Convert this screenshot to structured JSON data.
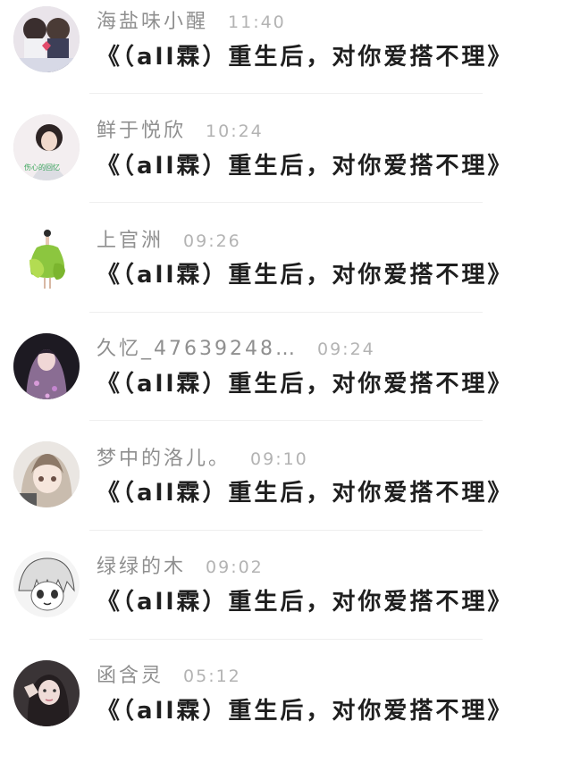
{
  "messages": [
    {
      "sender": "海盐味小醒",
      "time": "11:40",
      "text": "《（all霖）重生后，对你爱搭不理》",
      "avatar": "anime-couple-avatar"
    },
    {
      "sender": "鲜于悦欣",
      "time": "10:24",
      "text": "《（all霖）重生后，对你爱搭不理》",
      "avatar": "girl-photo-avatar",
      "avatar_caption": "伤心的回忆"
    },
    {
      "sender": "上官洲",
      "time": "09:26",
      "text": "《（all霖）重生后，对你爱搭不理》",
      "avatar": "green-dress-avatar"
    },
    {
      "sender": "久忆_47639248…",
      "time": "09:24",
      "text": "《（all霖）重生后，对你爱搭不理》",
      "avatar": "hooded-girl-avatar"
    },
    {
      "sender": "梦中的洛儿。",
      "time": "09:10",
      "text": "《（all霖）重生后，对你爱搭不理》",
      "avatar": "anime-girl-avatar"
    },
    {
      "sender": "绿绿的木",
      "time": "09:02",
      "text": "《（all霖）重生后，对你爱搭不理》",
      "avatar": "manga-girl-avatar"
    },
    {
      "sender": "函含灵",
      "time": "05:12",
      "text": "《（all霖）重生后，对你爱搭不理》",
      "avatar": "selfie-girl-avatar"
    }
  ],
  "colors": {
    "sender": "#8f8f8f",
    "time": "#b3b3b3",
    "message": "#1f1f1f",
    "separator": "#efefef"
  }
}
